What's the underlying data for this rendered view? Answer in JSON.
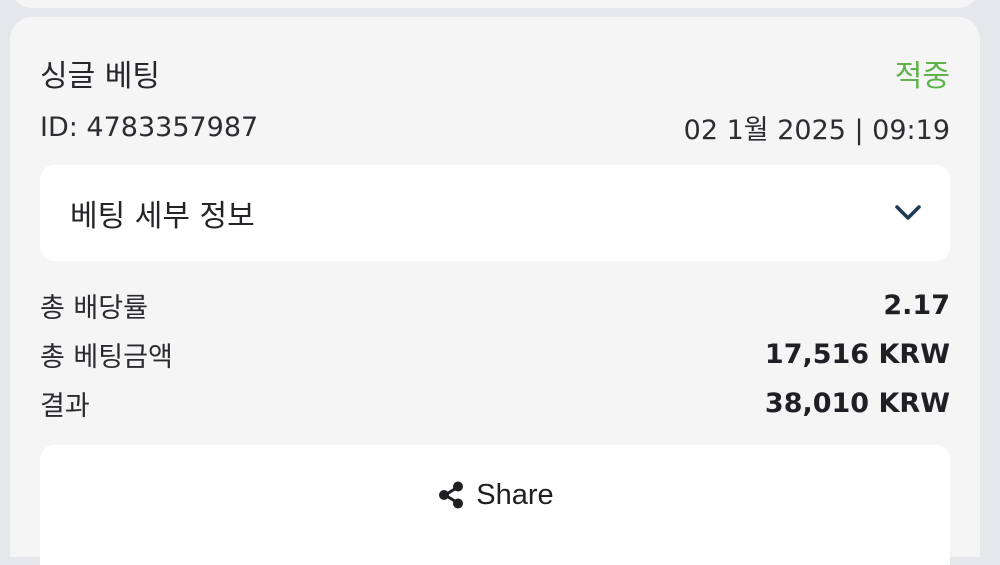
{
  "bet": {
    "title": "싱글 베팅",
    "status": "적중",
    "id_text": "ID: 4783357987",
    "datetime": "02 1월 2025 | 09:19"
  },
  "details": {
    "label": "베팅 세부 정보",
    "icon": "chevron-down-icon"
  },
  "stats": [
    {
      "label": "총 배당률",
      "value": "2.17"
    },
    {
      "label": "총 베팅금액",
      "value": "17,516 KRW"
    },
    {
      "label": "결과",
      "value": "38,010 KRW"
    }
  ],
  "share": {
    "label": "Share",
    "icon": "share-icon"
  },
  "colors": {
    "status_green": "#5fb34a",
    "chevron_navy": "#1f3a55",
    "background": "#e6e7ea",
    "card": "#f5f5f6"
  }
}
